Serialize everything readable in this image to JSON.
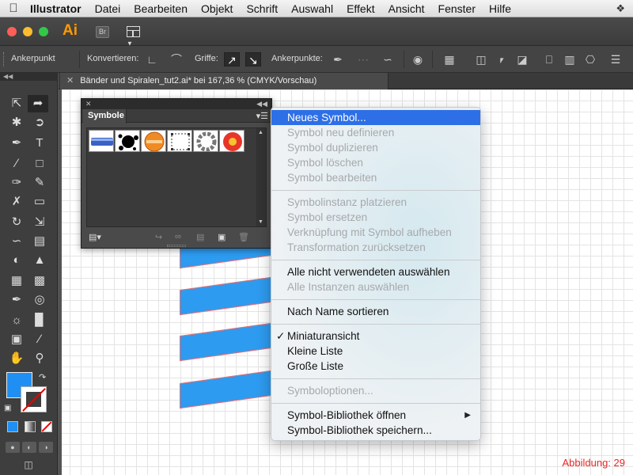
{
  "menubar": {
    "app_name": "Illustrator",
    "items": [
      "Datei",
      "Bearbeiten",
      "Objekt",
      "Schrift",
      "Auswahl",
      "Effekt",
      "Ansicht",
      "Fenster",
      "Hilfe"
    ]
  },
  "appbar": {
    "logo": "Ai",
    "bridge_label": "Br"
  },
  "controlbar": {
    "selection_label": "Ankerpunkt",
    "convert_label": "Konvertieren:",
    "handles_label": "Griffe:",
    "anchors_label": "Ankerpunkte:"
  },
  "document": {
    "tab_title": "Bänder und Spiralen_tut2.ai* bei 167,36 % (CMYK/Vorschau)"
  },
  "symbols_panel": {
    "tab_label": "Symbole"
  },
  "context_menu": {
    "items": [
      {
        "label": "Neues Symbol...",
        "state": "highlight"
      },
      {
        "label": "Symbol neu definieren",
        "state": "disabled"
      },
      {
        "label": "Symbol duplizieren",
        "state": "disabled"
      },
      {
        "label": "Symbol löschen",
        "state": "disabled"
      },
      {
        "label": "Symbol bearbeiten",
        "state": "disabled"
      },
      {
        "label": "Symbolinstanz platzieren",
        "state": "disabled"
      },
      {
        "label": "Symbol ersetzen",
        "state": "disabled"
      },
      {
        "label": "Verknüpfung mit Symbol aufheben",
        "state": "disabled"
      },
      {
        "label": "Transformation zurücksetzen",
        "state": "disabled"
      },
      {
        "label": "Alle nicht verwendeten auswählen",
        "state": "enabled"
      },
      {
        "label": "Alle Instanzen auswählen",
        "state": "disabled"
      },
      {
        "label": "Nach Name sortieren",
        "state": "enabled"
      },
      {
        "label": "Miniaturansicht",
        "state": "checked"
      },
      {
        "label": "Kleine Liste",
        "state": "enabled"
      },
      {
        "label": "Große Liste",
        "state": "enabled"
      },
      {
        "label": "Symboloptionen...",
        "state": "disabled"
      },
      {
        "label": "Symbol-Bibliothek öffnen",
        "state": "submenu"
      },
      {
        "label": "Symbol-Bibliothek speichern...",
        "state": "enabled"
      }
    ]
  },
  "colors": {
    "fill": "#1f8ff3",
    "stripe": "#2d9bf0",
    "highlight": "#2d6fe6",
    "figure_label": "#e22222"
  },
  "figure_label": "Abbildung: 29"
}
